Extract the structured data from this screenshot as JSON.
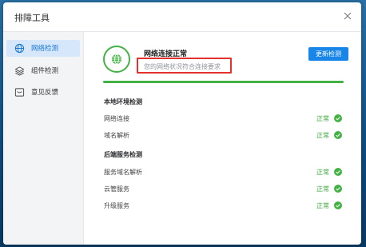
{
  "dialog": {
    "title": "排障工具"
  },
  "sidebar": {
    "items": [
      {
        "label": "网络检测",
        "icon": "globe-icon",
        "active": true
      },
      {
        "label": "组件检测",
        "icon": "layers-icon",
        "active": false
      },
      {
        "label": "意见反馈",
        "icon": "feedback-icon",
        "active": false
      }
    ]
  },
  "status": {
    "title": "网络连接正常",
    "description": "您的网络状况符合连接要求",
    "recheck_label": "更新检测",
    "progress": 1.0
  },
  "sections": [
    {
      "title": "本地环境检测",
      "rows": [
        {
          "label": "网络连接",
          "status": "正常"
        },
        {
          "label": "域名解析",
          "status": "正常"
        }
      ]
    },
    {
      "title": "后端服务检测",
      "rows": [
        {
          "label": "服务域名解析",
          "status": "正常"
        },
        {
          "label": "云管服务",
          "status": "正常"
        },
        {
          "label": "升级服务",
          "status": "正常"
        }
      ]
    }
  ],
  "colors": {
    "accent": "#1886e8",
    "success": "#43b244",
    "highlight": "#e3322c"
  }
}
